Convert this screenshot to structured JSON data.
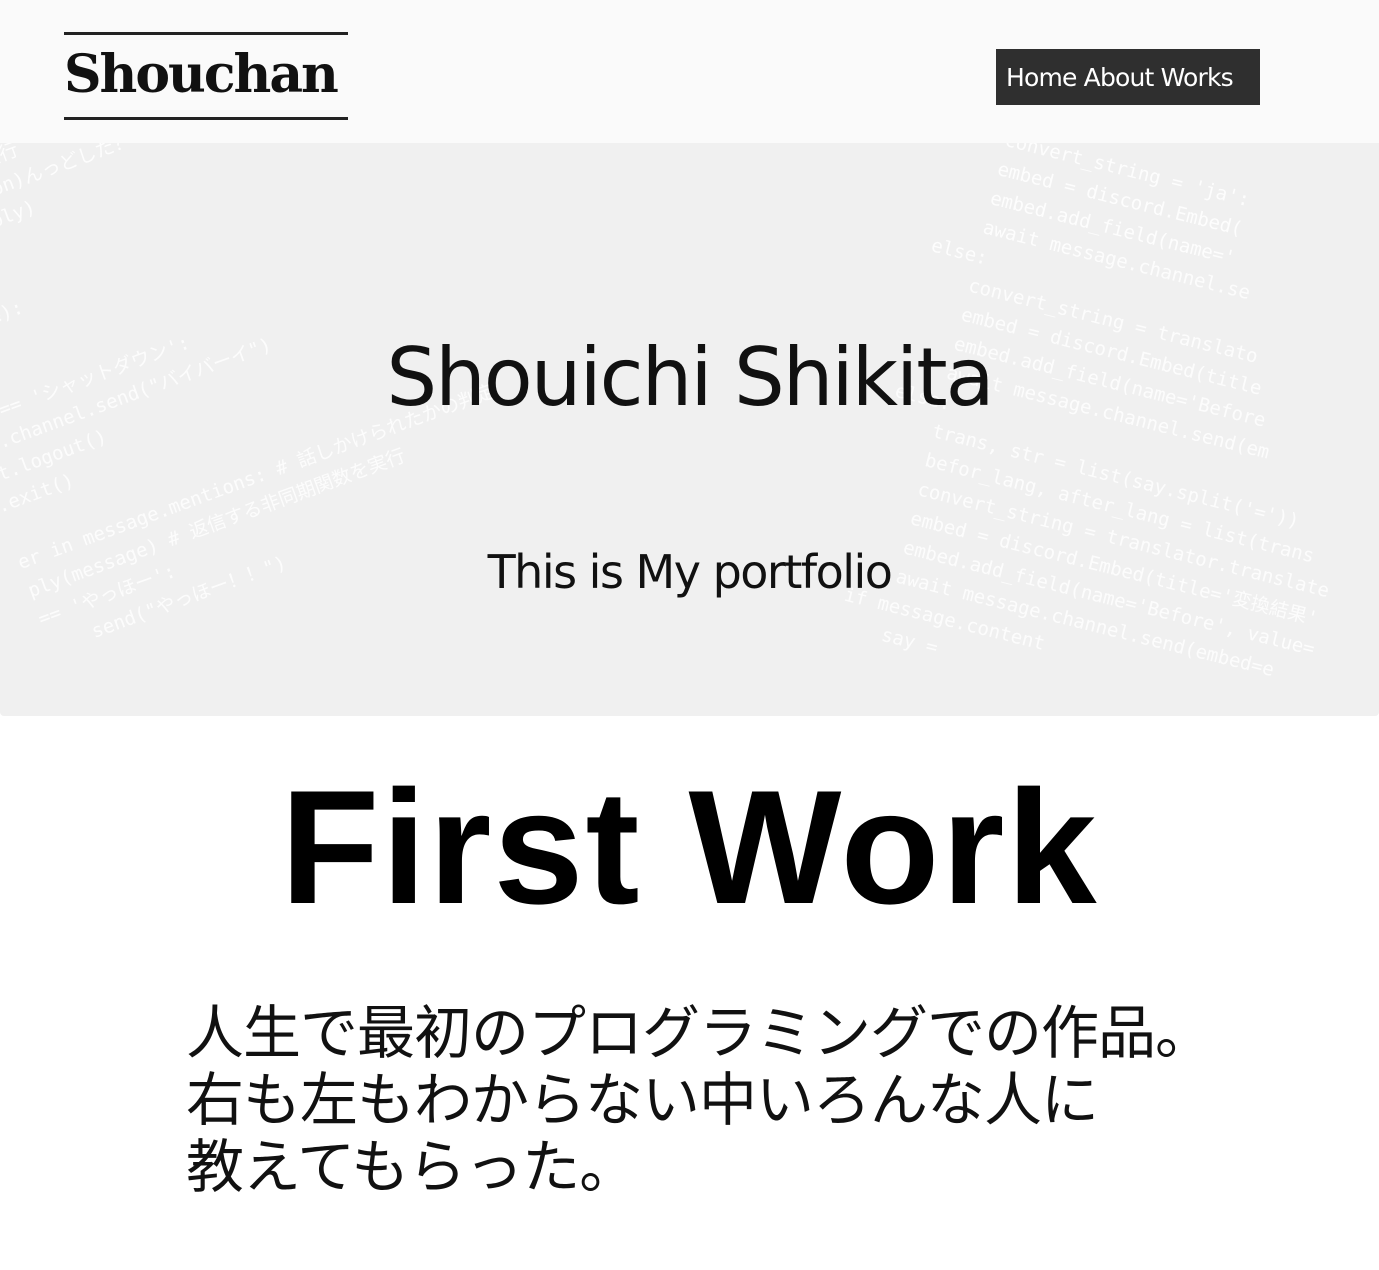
{
  "header": {
    "logo": "Shouchan",
    "nav": [
      "Home",
      "About",
      "Works"
    ]
  },
  "hero": {
    "title": "Shouichi Shikita",
    "subtitle": "This is My portfolio",
    "code_right": "        convert_string = 'ja':\n        embed = discord.Embed(\n        embed.add_field(name='\n        await message.channel.se\n    else:\n        convert_string = translato\n        embed = discord.Embed(title\n        embed.add_field(name='Before\n        await message.channel.send(em\n    else:\n        trans, str = list(say.split('='))\n        befor_lang, after_lang = list(trans\n        convert_string = translator.translate\n        embed = discord.Embed(title='変換結果'\n        embed.add_field(name='Before', value=\n        await message.channel.send(embed=e\n    if message.content\n        say =",
    "code_left": "  # 関数を実行\nhor.mention)んっどした？'#返信メッセージ\n.send(reply)\n\n\nessage):\n.bot:\n\nnt == 'シャットダウン':\nge.channel.send(\"バイバーイ\")\nnt.logout()\n.exit()\n\ner in message.mentions: # 話しかけられたかの判定\nply(message) # 返信する非同期関数を実行\n== 'やっほー':\n    send(\"やっほー！！\")"
  },
  "work": {
    "title": "First Work",
    "description": [
      "人生で最初のプログラミングでの作品。",
      "右も左もわからない中いろんな人に",
      "教えてもらった。"
    ]
  }
}
